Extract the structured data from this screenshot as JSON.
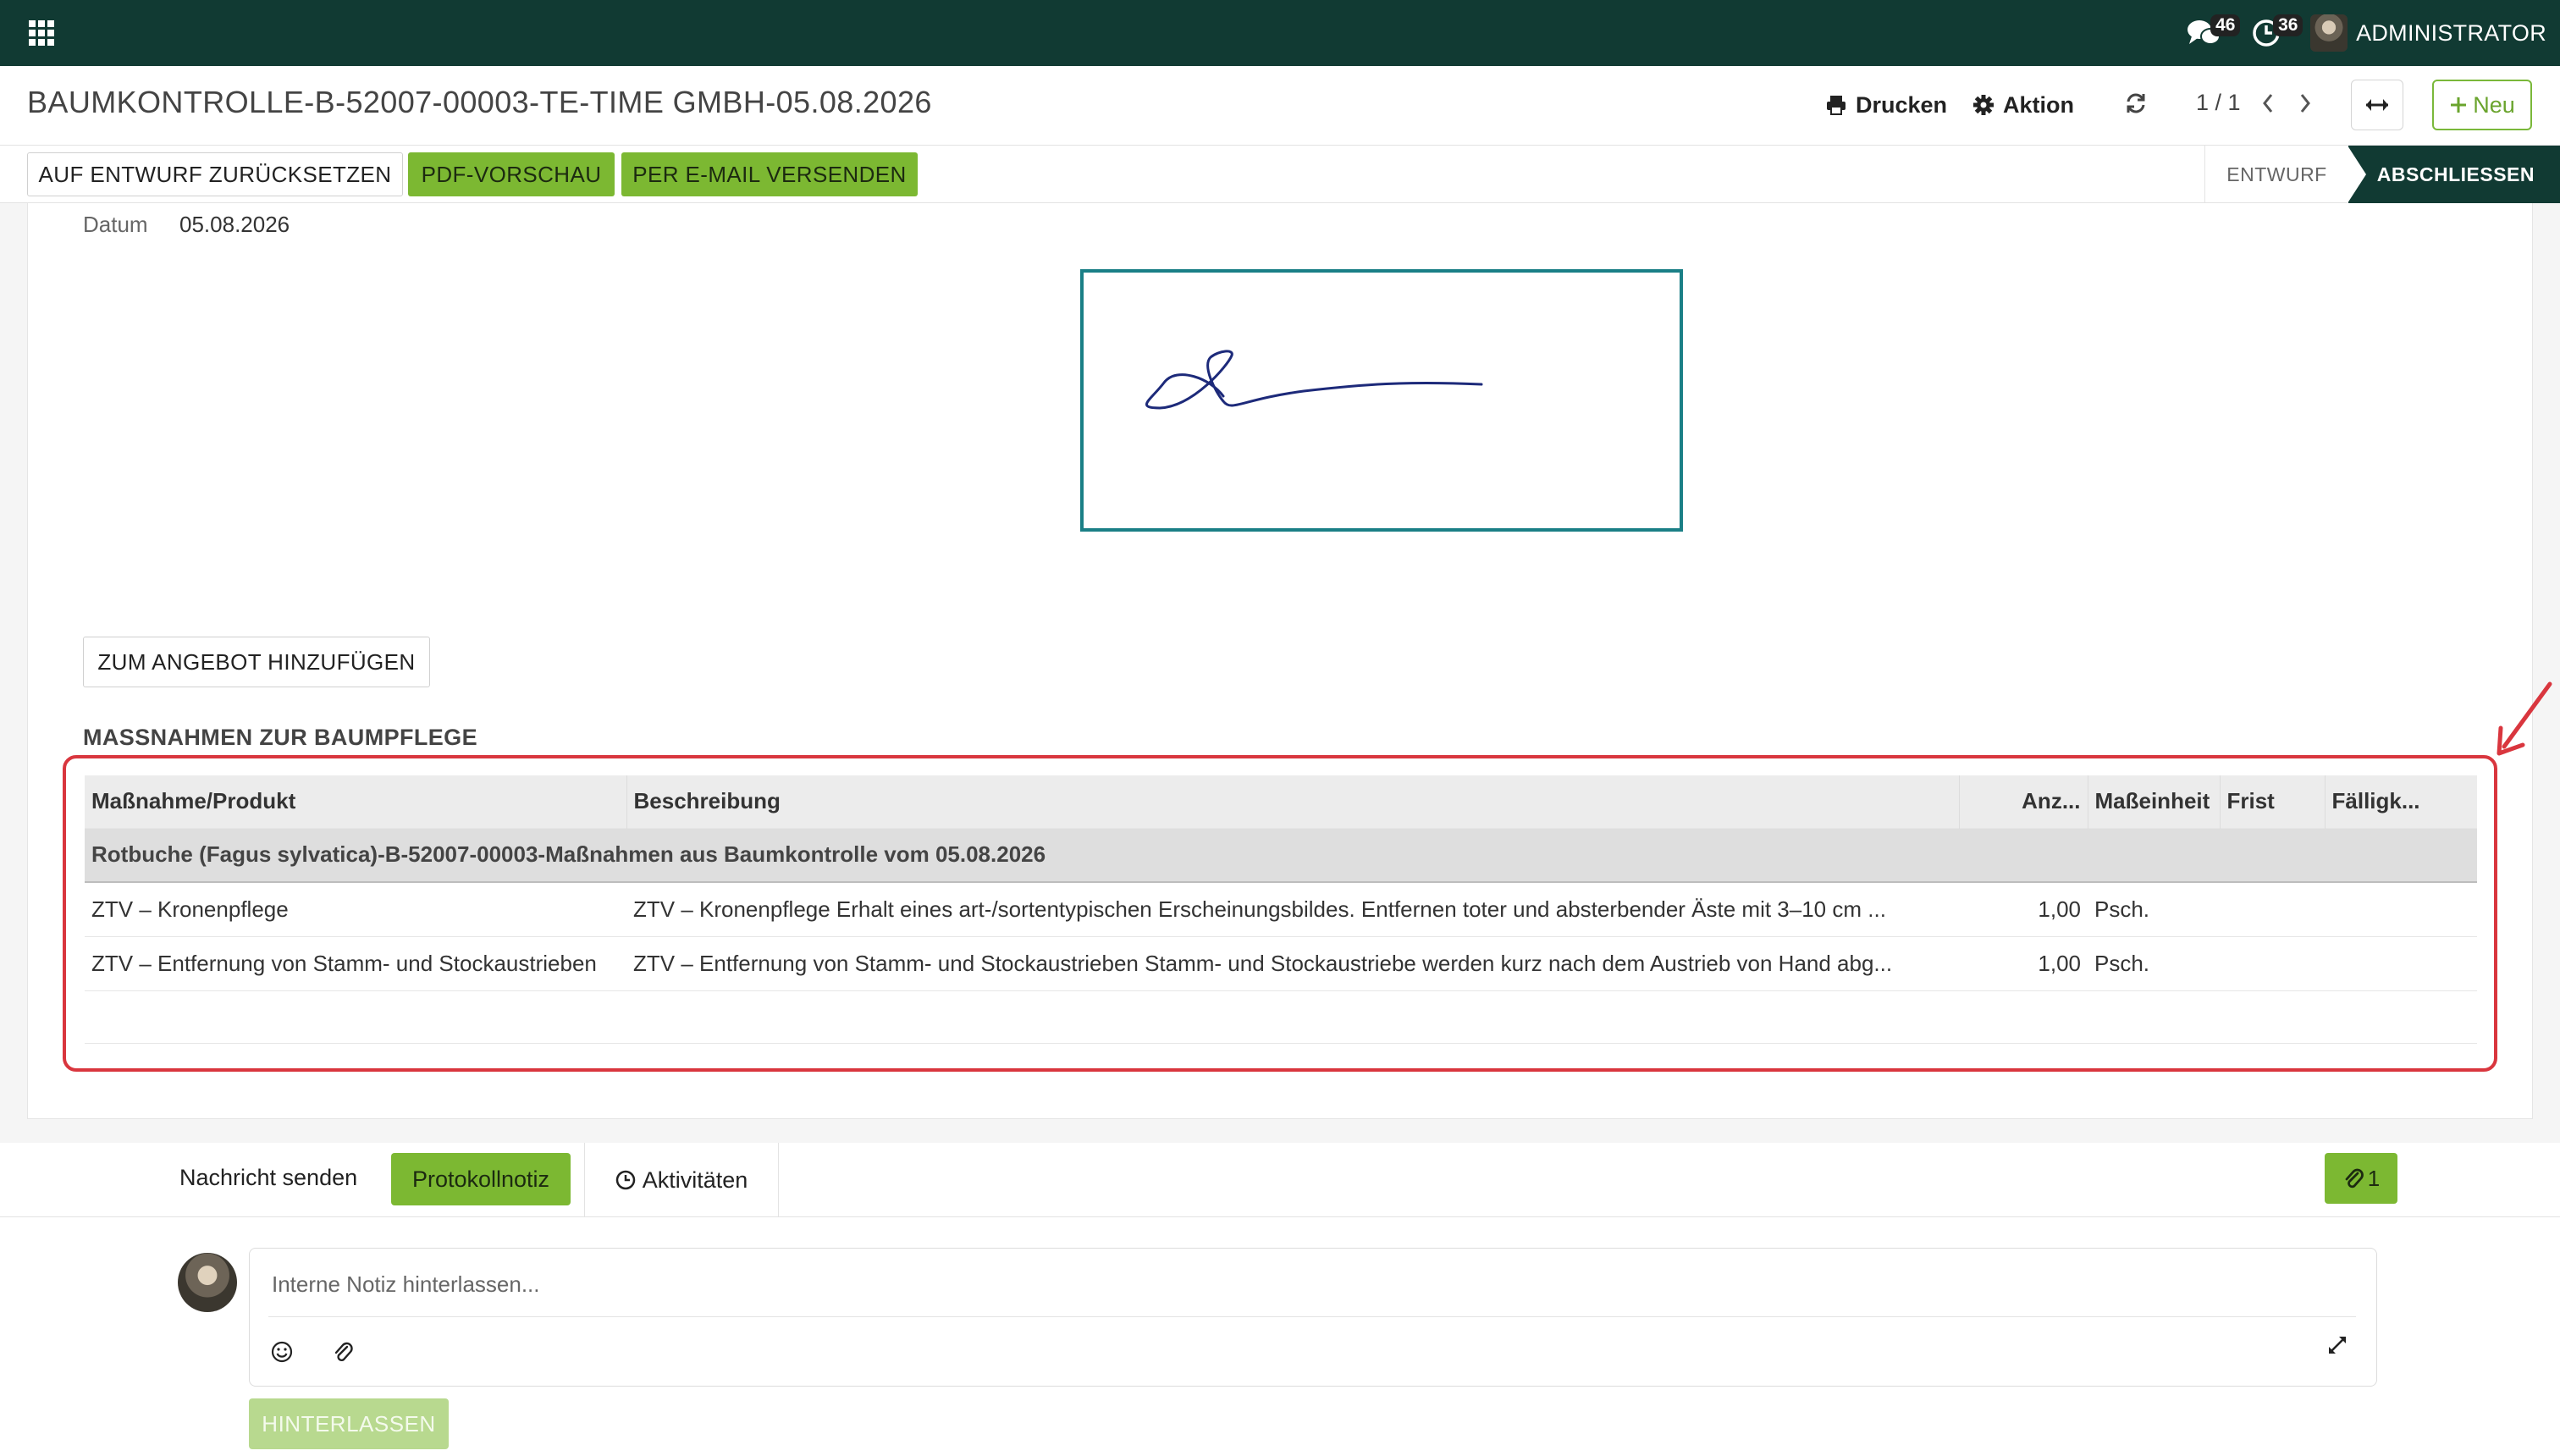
{
  "navbar": {
    "messages_count": "46",
    "activities_count": "36",
    "user_name": "ADMINISTRATOR"
  },
  "control": {
    "title": "BAUMKONTROLLE-B-52007-00003-TE-TIME GMBH-05.08.2026",
    "print_label": "Drucken",
    "action_label": "Aktion",
    "pager": "1 / 1",
    "new_label": "Neu"
  },
  "statusbar": {
    "reset_label": "AUF ENTWURF ZURÜCKSETZEN",
    "pdf_label": "PDF-VORSCHAU",
    "email_label": "PER E-MAIL VERSENDEN",
    "stage_draft": "ENTWURF",
    "stage_done": "ABSCHLIESSEN"
  },
  "form": {
    "datum_label": "Datum",
    "datum_value": "05.08.2026",
    "add_offer_label": "ZUM ANGEBOT HINZUFÜGEN",
    "section_title": "MASSNAHMEN ZUR BAUMPFLEGE"
  },
  "table": {
    "headers": [
      "Maßnahme/Produkt",
      "Beschreibung",
      "Anz...",
      "Maßeinheit",
      "Frist",
      "Fälligk..."
    ],
    "group_label": "Rotbuche (Fagus sylvatica)-B-52007-00003-Maßnahmen aus Baumkontrolle vom 05.08.2026",
    "rows": [
      {
        "product": "ZTV – Kronenpflege",
        "description": "ZTV – Kronenpflege Erhalt eines art-/sortentypischen Erscheinungsbildes. Entfernen toter und absterbender Äste mit 3–10 cm ...",
        "qty": "1,00",
        "unit": "Psch.",
        "deadline": "",
        "due": ""
      },
      {
        "product": "ZTV – Entfernung von Stamm- und Stockaustrieben",
        "description": "ZTV – Entfernung von Stamm- und Stockaustrieben Stamm- und Stockaustriebe werden kurz nach dem Austrieb von Hand abg...",
        "qty": "1,00",
        "unit": "Psch.",
        "deadline": "",
        "due": ""
      }
    ]
  },
  "chatter": {
    "send_message": "Nachricht senden",
    "log_note": "Protokollnotiz",
    "activities": "Aktivitäten",
    "attachments_count": "1",
    "placeholder": "Interne Notiz hinterlassen...",
    "submit_label": "HINTERLASSEN"
  },
  "colors": {
    "navbar": "#113a33",
    "accent_green": "#7cb832",
    "signature_border": "#1a7f86",
    "highlight_red": "#d9363e",
    "signature_ink": "#1d2a7a"
  }
}
